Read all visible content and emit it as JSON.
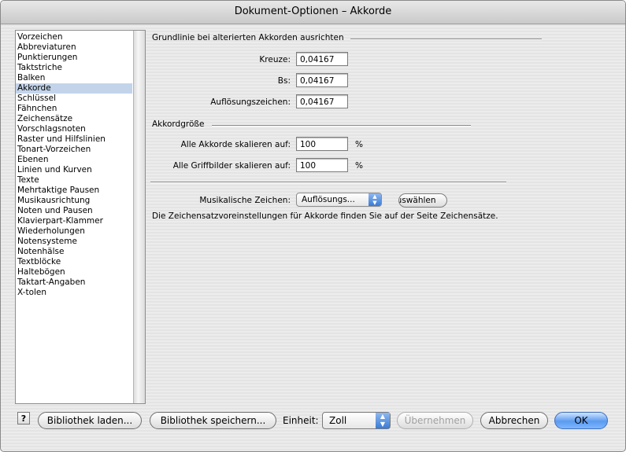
{
  "window": {
    "title": "Dokument-Optionen – Akkorde"
  },
  "sidebar": {
    "items": [
      "Vorzeichen",
      "Abbreviaturen",
      "Punktierungen",
      "Taktstriche",
      "Balken",
      "Akkorde",
      "Schlüssel",
      "Fähnchen",
      "Zeichensätze",
      "Vorschlagsnoten",
      "Raster und Hilfslinien",
      "Tonart-Vorzeichen",
      "Ebenen",
      "Linien und Kurven",
      "Texte",
      "Mehrtaktige Pausen",
      "Musikausrichtung",
      "Noten und Pausen",
      "Klavierpart-Klammer",
      "Wiederholungen",
      "Notensysteme",
      "Notenhälse",
      "Textblöcke",
      "Haltebögen",
      "Taktart-Angaben",
      "X-tolen"
    ],
    "selected": "Akkorde"
  },
  "baseline": {
    "title": "Grundlinie bei alterierten Akkorden ausrichten",
    "kreuze_label": "Kreuze:",
    "kreuze_value": "0,04167",
    "bs_label": "Bs:",
    "bs_value": "0,04167",
    "aufl_label": "Auflösungszeichen:",
    "aufl_value": "0,04167"
  },
  "size": {
    "title": "Akkordgröße",
    "akkorde_label": "Alle Akkorde skalieren auf:",
    "akkorde_value": "100",
    "akkorde_unit": "%",
    "griff_label": "Alle Griffbilder skalieren auf:",
    "griff_value": "100",
    "griff_unit": "%"
  },
  "music": {
    "label": "Musikalische Zeichen:",
    "popup_value": "Auflösungs...",
    "choose_label": "Auswählen",
    "info": "Die Zeichensatzvoreinstellungen für Akkorde finden Sie auf der Seite Zeichensätze."
  },
  "footer": {
    "help_label": "?",
    "load_label": "Bibliothek laden...",
    "save_label": "Bibliothek speichern...",
    "unit_label": "Einheit:",
    "unit_value": "Zoll",
    "apply_label": "Übernehmen",
    "cancel_label": "Abbrechen",
    "ok_label": "OK"
  },
  "colors": {
    "selection": "#c3d4ea",
    "default_button": "#5b9bf0"
  }
}
